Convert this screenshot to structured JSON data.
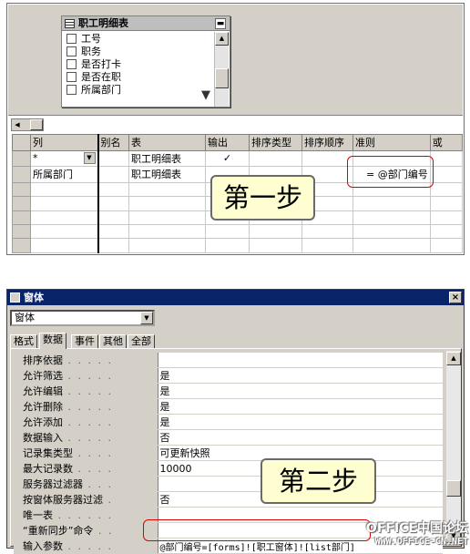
{
  "query_design": {
    "field_list": {
      "title": "职工明细表",
      "fields": [
        "工号",
        "职务",
        "是否打卡",
        "是否在职",
        "所属部门"
      ]
    },
    "grid": {
      "row_headers": [
        "列",
        "别名",
        "表",
        "输出",
        "排序类型",
        "排序顺序",
        "准则",
        "或"
      ],
      "rows": [
        {
          "column": "*",
          "alias": "",
          "table": "职工明细表",
          "output": "✓",
          "sort_type": "",
          "sort_order": "",
          "criteria": "",
          "or": ""
        },
        {
          "column": "所属部门",
          "alias": "",
          "table": "职工明细表",
          "output": "",
          "sort_type": "",
          "sort_order": "",
          "criteria": "= @部门编号",
          "or": ""
        }
      ]
    },
    "step_label": "第一步"
  },
  "properties_window": {
    "title": "窗体",
    "object_selector": "窗体",
    "tabs": [
      "格式",
      "数据",
      "事件",
      "其他",
      "全部"
    ],
    "active_tab": "数据",
    "properties": [
      {
        "name": "排序依据",
        "value": ""
      },
      {
        "name": "允许筛选",
        "value": "是"
      },
      {
        "name": "允许编辑",
        "value": "是"
      },
      {
        "name": "允许删除",
        "value": "是"
      },
      {
        "name": "允许添加",
        "value": "是"
      },
      {
        "name": "数据输入",
        "value": "否"
      },
      {
        "name": "记录集类型",
        "value": "可更新快照"
      },
      {
        "name": "最大记录数",
        "value": "10000"
      },
      {
        "name": "服务器过滤器",
        "value": ""
      },
      {
        "name": "按窗体服务器过滤",
        "value": "否"
      },
      {
        "name": "唯一表",
        "value": ""
      },
      {
        "name": "“重新同步”命令",
        "value": ""
      },
      {
        "name": "输入参数",
        "value": "@部门编号=[forms]![职工窗体]![list部门]"
      }
    ],
    "step_label": "第二步"
  },
  "watermark": {
    "line1": "OFFICE中国论坛",
    "line2": "WWW.OFFICE-CN.NET"
  }
}
